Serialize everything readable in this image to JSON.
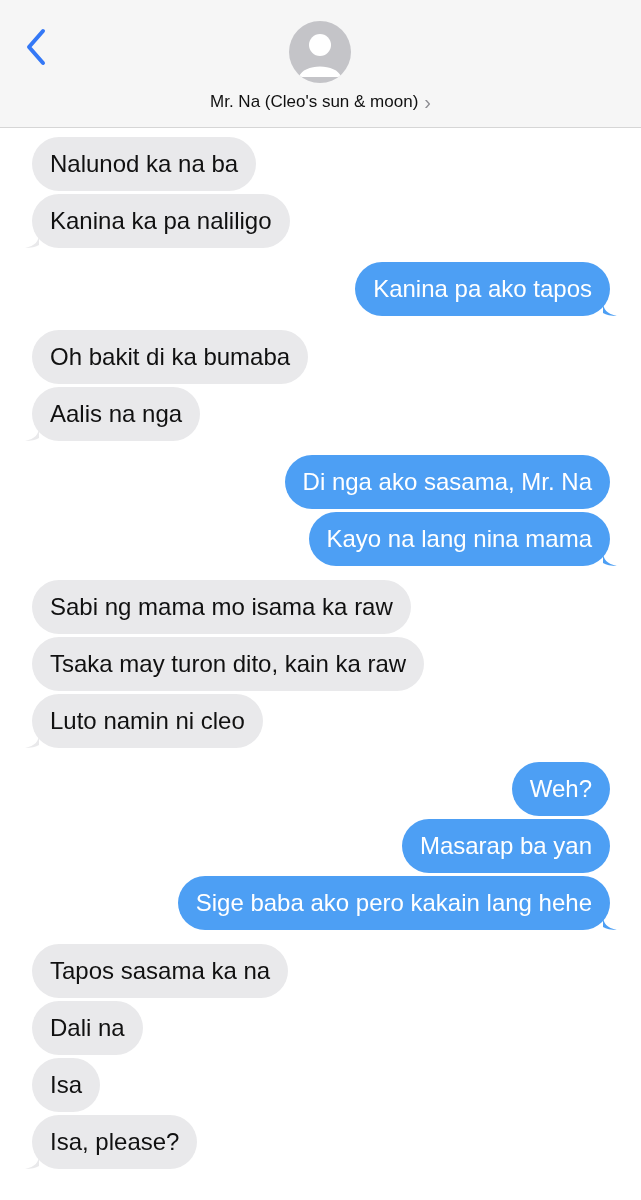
{
  "header": {
    "contact_name": "Mr. Na (Cleo's sun & moon)",
    "name_chevron": "›"
  },
  "messages": [
    {
      "kind": "received",
      "text": "Nalunod ka na ba"
    },
    {
      "kind": "received",
      "text": "Kanina ka pa naliligo"
    },
    {
      "kind": "sent",
      "text": "Kanina pa ako tapos"
    },
    {
      "kind": "received",
      "text": "Oh bakit di ka bumaba"
    },
    {
      "kind": "received",
      "text": "Aalis na nga"
    },
    {
      "kind": "sent",
      "text": "Di nga ako sasama, Mr. Na"
    },
    {
      "kind": "sent",
      "text": "Kayo na lang nina mama"
    },
    {
      "kind": "received",
      "text": "Sabi ng mama mo isama ka raw"
    },
    {
      "kind": "received",
      "text": "Tsaka may turon dito, kain ka raw"
    },
    {
      "kind": "received",
      "text": "Luto namin ni cleo"
    },
    {
      "kind": "sent",
      "text": "Weh?"
    },
    {
      "kind": "sent",
      "text": "Masarap ba yan"
    },
    {
      "kind": "sent",
      "text": "Sige baba ako pero kakain lang hehe"
    },
    {
      "kind": "received",
      "text": "Tapos sasama ka na"
    },
    {
      "kind": "received",
      "text": "Dali na"
    },
    {
      "kind": "received",
      "text": "Isa"
    },
    {
      "kind": "received",
      "text": "Isa, please?"
    }
  ]
}
